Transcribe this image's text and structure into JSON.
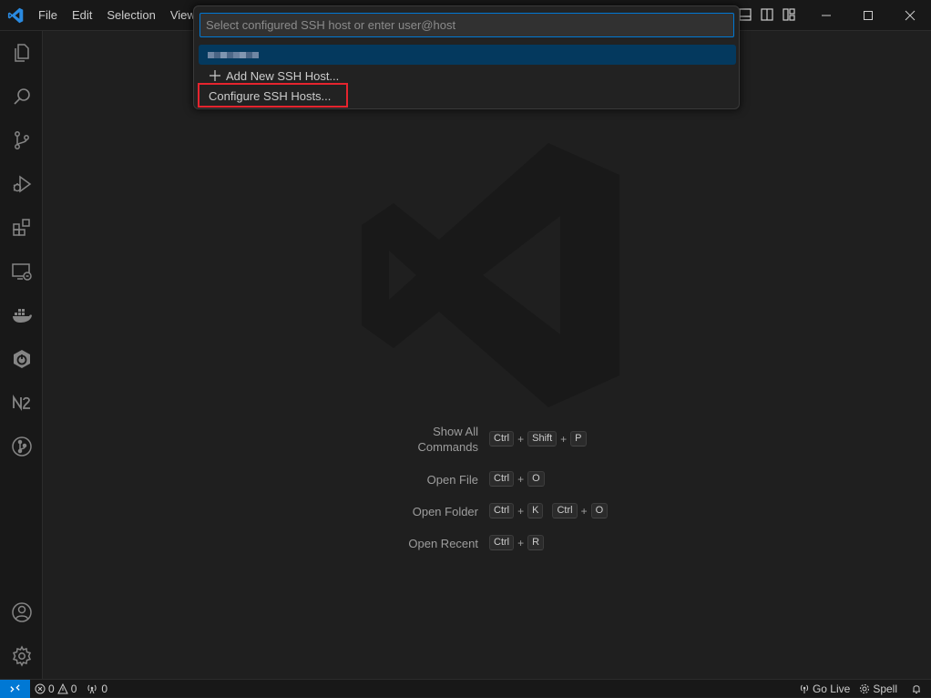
{
  "titlebar": {
    "menu": [
      "File",
      "Edit",
      "Selection",
      "View"
    ],
    "layout_icons": [
      "toggle-panel-icon",
      "toggle-secondary-sidebar-icon",
      "customize-layout-icon"
    ],
    "window_controls": [
      "minimize-icon",
      "maximize-icon",
      "close-icon"
    ]
  },
  "activitybar": {
    "top": [
      "explorer-icon",
      "search-icon",
      "source-control-icon",
      "run-debug-icon",
      "extensions-icon",
      "remote-explorer-icon",
      "docker-icon",
      "spring-boot-icon",
      "n2-icon",
      "git-graph-icon"
    ],
    "bottom": [
      "accounts-icon",
      "manage-gear-icon"
    ]
  },
  "quick_pick": {
    "placeholder": "Select configured SSH host or enter user@host",
    "value": "",
    "host_item_obscured": true,
    "add_label": "Add New SSH Host...",
    "configure_label": "Configure SSH Hosts..."
  },
  "shortcuts": [
    {
      "label_line1": "Show All",
      "label_line2": "Commands",
      "keys": [
        [
          "Ctrl",
          "Shift",
          "P"
        ]
      ]
    },
    {
      "label": "Open File",
      "keys": [
        [
          "Ctrl",
          "O"
        ]
      ]
    },
    {
      "label": "Open Folder",
      "keys": [
        [
          "Ctrl",
          "K"
        ],
        [
          "Ctrl",
          "O"
        ]
      ]
    },
    {
      "label": "Open Recent",
      "keys": [
        [
          "Ctrl",
          "R"
        ]
      ]
    }
  ],
  "statusbar": {
    "errors": "0",
    "warnings": "0",
    "ports": "0",
    "go_live": "Go Live",
    "spell": "Spell"
  },
  "colors": {
    "accent": "#0078d4",
    "selected_item": "#04395e",
    "highlight_box": "#e5242e"
  }
}
